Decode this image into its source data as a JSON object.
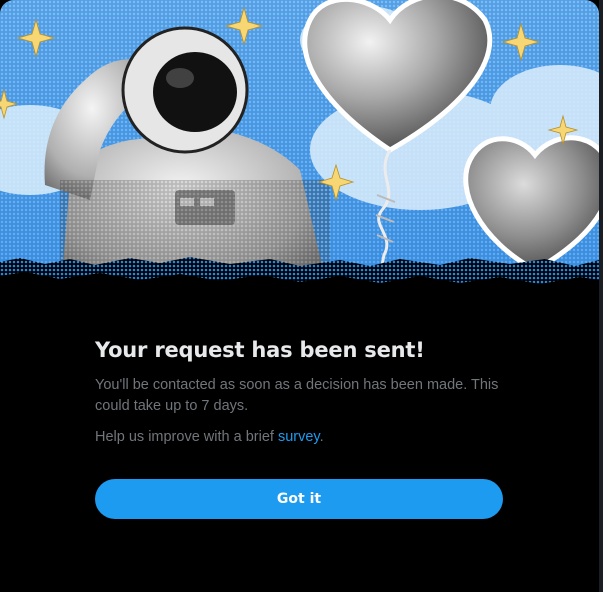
{
  "dialog": {
    "title": "Your request has been sent!",
    "body": "You'll be contacted as soon as a decision has been made. This could take up to 7 days.",
    "help_prefix": "Help us improve with a brief ",
    "help_link": "survey",
    "help_suffix": ".",
    "button_label": "Got it"
  },
  "colors": {
    "background": "#000000",
    "accent": "#1d9bf0",
    "title_text": "#e7e9ea",
    "secondary_text": "#71767b",
    "hero_sky": "#4a9ee6"
  },
  "illustration": {
    "subject": "astronaut-with-balloons",
    "icons": [
      "sparkle-icon",
      "balloon-icon",
      "astronaut-icon"
    ]
  }
}
